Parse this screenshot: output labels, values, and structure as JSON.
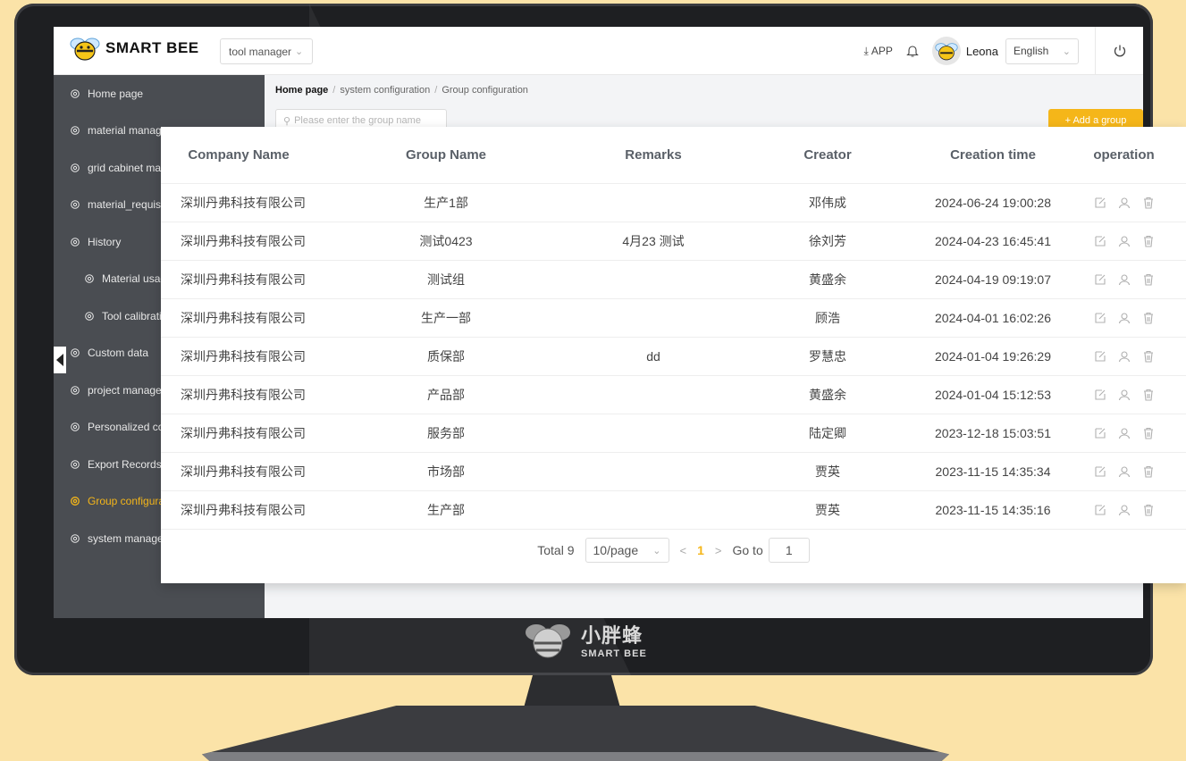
{
  "app": {
    "logo_text": "SMART BEE",
    "tool_selector": "tool manager",
    "app_download": "APP",
    "username": "Leona",
    "language": "English"
  },
  "sidebar": {
    "items": [
      {
        "label": "Home page"
      },
      {
        "label": "material manageme"
      },
      {
        "label": "grid cabinet manag"
      },
      {
        "label": "material_requisition"
      },
      {
        "label": "History"
      },
      {
        "label": "Material usage r"
      },
      {
        "label": "Tool calibration"
      },
      {
        "label": "Custom data"
      },
      {
        "label": "project managemen"
      },
      {
        "label": "Personalized config"
      },
      {
        "label": "Export Records"
      },
      {
        "label": "Group configuratio"
      },
      {
        "label": "system managemen"
      }
    ]
  },
  "breadcrumb": [
    "Home page",
    "system configuration",
    "Group configuration"
  ],
  "search": {
    "placeholder": "Please enter the group name"
  },
  "add_button": "+ Add a group",
  "table": {
    "headers": [
      "Company Name",
      "Group Name",
      "Remarks",
      "Creator",
      "Creation time",
      "operation"
    ],
    "rows": [
      [
        "深圳丹弗科技有限公司",
        "生产1部",
        "",
        "邓伟成",
        "2024-06-24 19:00:28"
      ],
      [
        "深圳丹弗科技有限公司",
        "测试0423",
        "4月23 测试",
        "徐刘芳",
        "2024-04-23 16:45:41"
      ],
      [
        "深圳丹弗科技有限公司",
        "测试组",
        "",
        "黄盛余",
        "2024-04-19 09:19:07"
      ],
      [
        "深圳丹弗科技有限公司",
        "生产一部",
        "",
        "顾浩",
        "2024-04-01 16:02:26"
      ],
      [
        "深圳丹弗科技有限公司",
        "质保部",
        "dd",
        "罗慧忠",
        "2024-01-04 19:26:29"
      ],
      [
        "深圳丹弗科技有限公司",
        "产品部",
        "",
        "黄盛余",
        "2024-01-04 15:12:53"
      ],
      [
        "深圳丹弗科技有限公司",
        "服务部",
        "",
        "陆定卿",
        "2023-12-18 15:03:51"
      ],
      [
        "深圳丹弗科技有限公司",
        "市场部",
        "",
        "贾英",
        "2023-11-15 14:35:34"
      ],
      [
        "深圳丹弗科技有限公司",
        "生产部",
        "",
        "贾英",
        "2023-11-15 14:35:16"
      ]
    ]
  },
  "pagination": {
    "total": "Total 9",
    "page_size": "10/page",
    "prev": "<",
    "current": "1",
    "next": ">",
    "goto_label": "Go to",
    "goto_value": "1"
  },
  "bezel": {
    "brand_cn": "小胖蜂",
    "brand_en": "SMART BEE"
  },
  "colors": {
    "accent": "#f5b619",
    "sidebar": "#4a4d52",
    "background": "#fbe3a8"
  },
  "icons": [
    "bee-logo-icon",
    "chevron-down-icon",
    "download-icon",
    "bell-icon",
    "power-icon",
    "gear-icon",
    "search-icon",
    "edit-icon",
    "user-icon",
    "delete-icon",
    "collapse-arrow-icon"
  ]
}
